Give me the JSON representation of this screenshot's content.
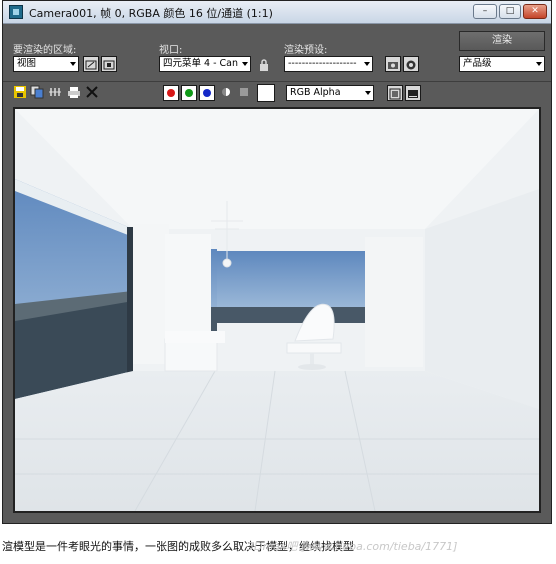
{
  "window": {
    "title": "Camera001, 帧 0, RGBA 颜色 16 位/通道 (1:1)",
    "buttons": {
      "minimize": "–",
      "maximize": "□",
      "close": "✕"
    }
  },
  "toolbar": {
    "area_label": "要渲染的区域:",
    "area_value": "视图",
    "viewport_label": "视口:",
    "viewport_value": "四元菜单 4 - Can",
    "preset_label": "渲染预设:",
    "preset_value": "--------------------",
    "render_button": "渲染",
    "quality_value": "产品级",
    "channel_value": "RGB Alpha"
  },
  "channels": {
    "red": "#d81818",
    "green": "#109a18",
    "blue": "#1428c8"
  },
  "icons": [
    "save-icon",
    "copy-icon",
    "clone-icon",
    "print-icon",
    "clear-icon",
    "lock-icon",
    "mono-icon",
    "background-icon"
  ],
  "caption": {
    "text": "渲模型是一件考眼光的事情，一张图的成败多么取决于模型，继续找模型",
    "watermark": "3Dmax吧 [www.tieba.com/tieba/1771]"
  }
}
